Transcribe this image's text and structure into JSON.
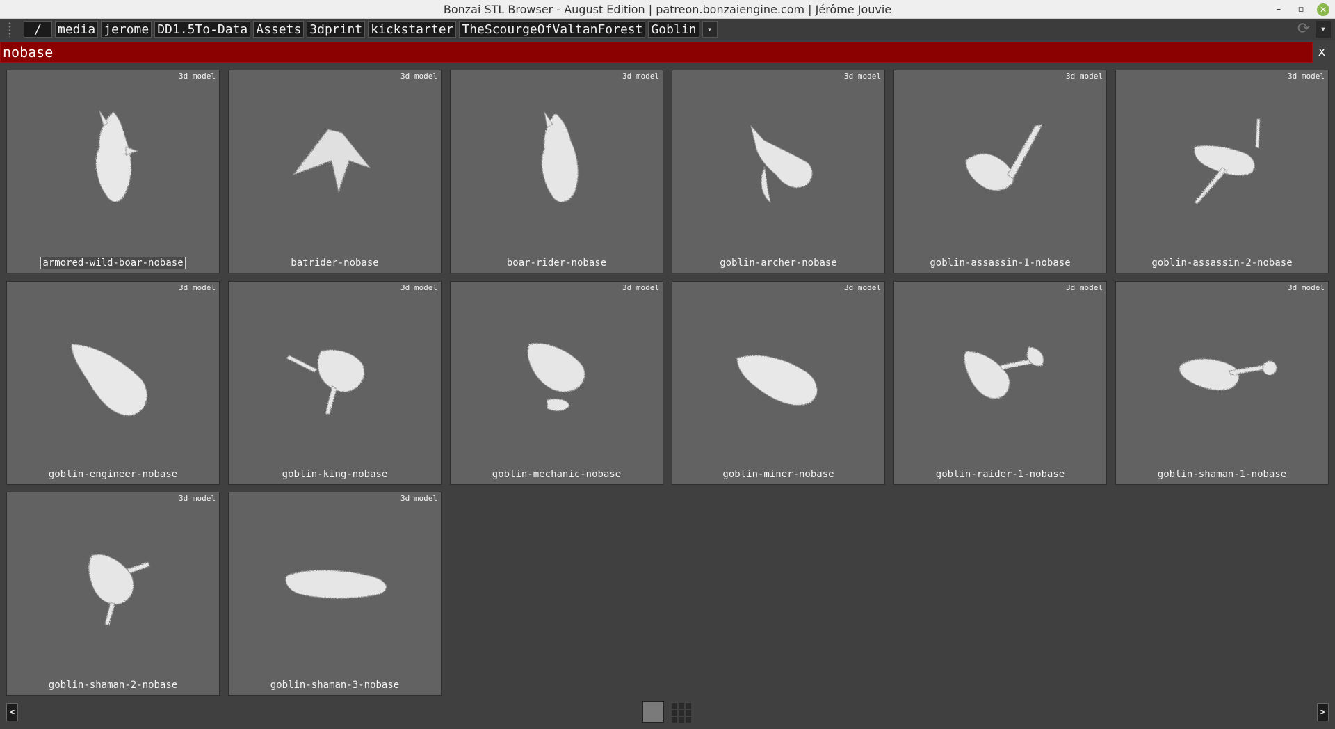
{
  "window": {
    "title": "Bonzai STL Browser - August Edition | patreon.bonzaiengine.com | Jérôme Jouvie",
    "controls": {
      "minimize": "–",
      "maximize": "▫",
      "close": "✕"
    }
  },
  "breadcrumb": {
    "root": "/",
    "items": [
      "media",
      "jerome",
      "DD1.5To-Data",
      "Assets",
      "3dprint",
      "kickstarter",
      "TheScourgeOfValtanForest",
      "Goblin"
    ],
    "more_icon": "▾",
    "refresh_icon": "⟳",
    "menu_icon": "▾"
  },
  "search": {
    "value": "nobase",
    "clear_label": "x",
    "bar_color": "#8b0000"
  },
  "models": [
    {
      "badge": "3d model",
      "name": "armored-wild-boar-nobase",
      "selected": true
    },
    {
      "badge": "3d model",
      "name": "batrider-nobase"
    },
    {
      "badge": "3d model",
      "name": "boar-rider-nobase"
    },
    {
      "badge": "3d model",
      "name": "goblin-archer-nobase"
    },
    {
      "badge": "3d model",
      "name": "goblin-assassin-1-nobase"
    },
    {
      "badge": "3d model",
      "name": "goblin-assassin-2-nobase"
    },
    {
      "badge": "3d model",
      "name": "goblin-engineer-nobase"
    },
    {
      "badge": "3d model",
      "name": "goblin-king-nobase"
    },
    {
      "badge": "3d model",
      "name": "goblin-mechanic-nobase"
    },
    {
      "badge": "3d model",
      "name": "goblin-miner-nobase"
    },
    {
      "badge": "3d model",
      "name": "goblin-raider-1-nobase"
    },
    {
      "badge": "3d model",
      "name": "goblin-shaman-1-nobase"
    },
    {
      "badge": "3d model",
      "name": "goblin-shaman-2-nobase"
    },
    {
      "badge": "3d model",
      "name": "goblin-shaman-3-nobase"
    }
  ],
  "footer": {
    "prev_label": "<",
    "next_label": ">"
  }
}
